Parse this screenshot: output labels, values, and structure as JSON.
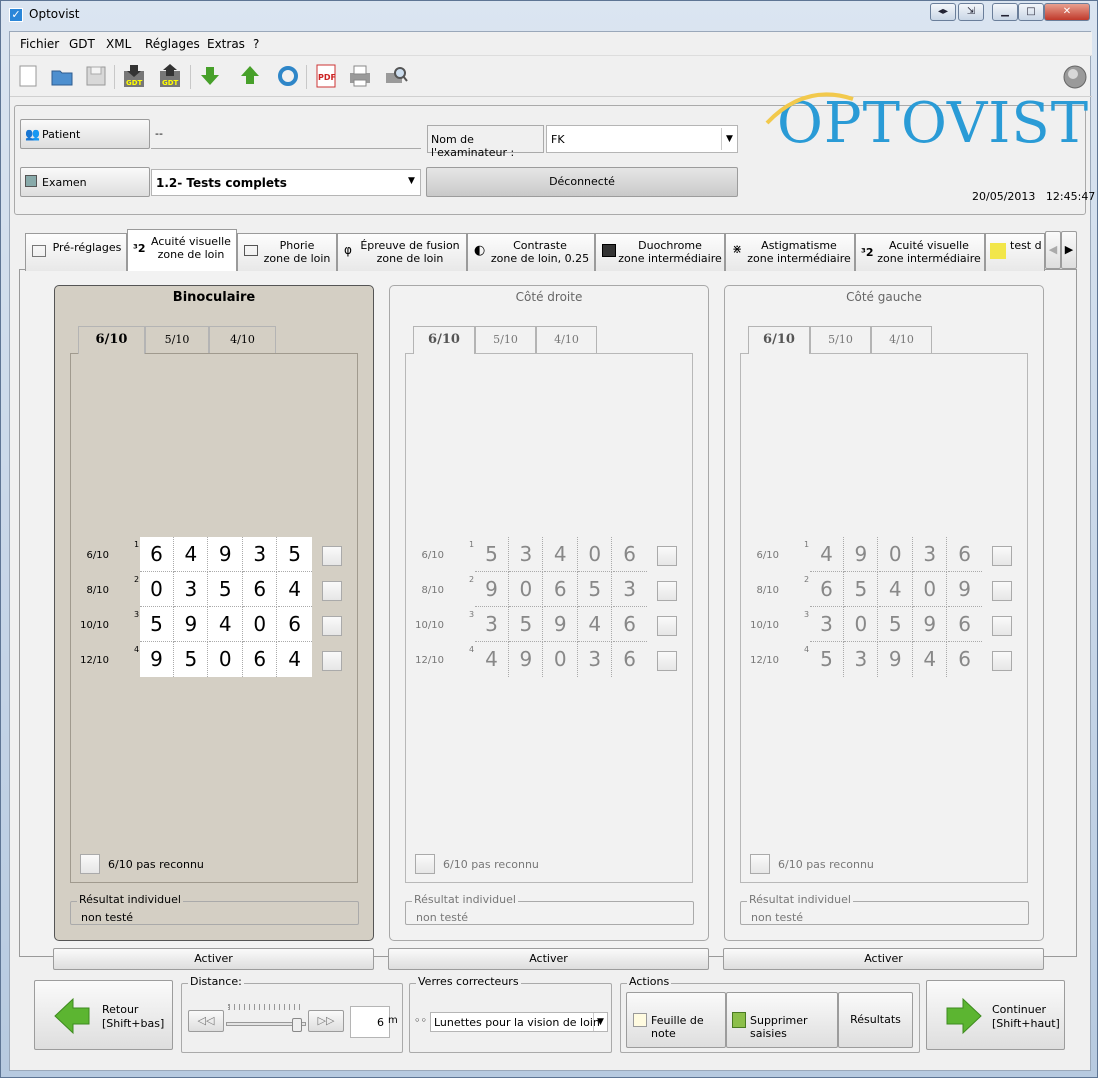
{
  "window": {
    "title": "Optovist"
  },
  "menu": [
    "Fichier",
    "GDT",
    "XML",
    "Réglages",
    "Extras",
    "?"
  ],
  "toolbar_icons": [
    "new-file-icon",
    "open-folder-icon",
    "save-icon",
    "gdt-import-icon",
    "gdt-export-icon",
    "arrow-down-icon",
    "arrow-up-icon",
    "refresh-icon",
    "pdf-icon",
    "print-icon",
    "print-preview-icon"
  ],
  "header": {
    "patient_label": "Patient",
    "patient_value": "--",
    "examen_label": "Examen",
    "examen_value": "1.2- Tests complets",
    "examiner_label": "Nom de l'examinateur :",
    "examiner_value": "FK",
    "connection_button": "Déconnecté",
    "logo": "OPTOVIST",
    "date": "20/05/2013",
    "time": "12:45:47"
  },
  "tabs": [
    {
      "line1": "Pré-réglages",
      "line2": ""
    },
    {
      "line1": "Acuité visuelle",
      "line2": "zone de loin"
    },
    {
      "line1": "Phorie",
      "line2": "zone de loin"
    },
    {
      "line1": "Épreuve de fusion",
      "line2": "zone de loin"
    },
    {
      "line1": "Contraste",
      "line2": "zone de loin, 0.25"
    },
    {
      "line1": "Duochrome",
      "line2": "zone intermédiaire"
    },
    {
      "line1": "Astigmatisme",
      "line2": "zone intermédiaire"
    },
    {
      "line1": "Acuité visuelle",
      "line2": "zone intermédiaire"
    },
    {
      "line1": "test d",
      "line2": ""
    }
  ],
  "panels": [
    {
      "title": "Binoculaire",
      "subtabs": [
        "6/10",
        "5/10",
        "4/10"
      ],
      "rows": [
        {
          "label": "6/10",
          "num": "1",
          "digits": [
            "6",
            "4",
            "9",
            "3",
            "5"
          ]
        },
        {
          "label": "8/10",
          "num": "2",
          "digits": [
            "0",
            "3",
            "5",
            "6",
            "4"
          ]
        },
        {
          "label": "10/10",
          "num": "3",
          "digits": [
            "5",
            "9",
            "4",
            "0",
            "6"
          ]
        },
        {
          "label": "12/10",
          "num": "4",
          "digits": [
            "9",
            "5",
            "0",
            "6",
            "4"
          ]
        }
      ],
      "not_recognized": "6/10 pas reconnu",
      "result_label": "Résultat individuel",
      "result_value": "non testé",
      "activate": "Activer"
    },
    {
      "title": "Côté droite",
      "subtabs": [
        "6/10",
        "5/10",
        "4/10"
      ],
      "rows": [
        {
          "label": "6/10",
          "num": "1",
          "digits": [
            "5",
            "3",
            "4",
            "0",
            "6"
          ]
        },
        {
          "label": "8/10",
          "num": "2",
          "digits": [
            "9",
            "0",
            "6",
            "5",
            "3"
          ]
        },
        {
          "label": "10/10",
          "num": "3",
          "digits": [
            "3",
            "5",
            "9",
            "4",
            "6"
          ]
        },
        {
          "label": "12/10",
          "num": "4",
          "digits": [
            "4",
            "9",
            "0",
            "3",
            "6"
          ]
        }
      ],
      "not_recognized": "6/10 pas reconnu",
      "result_label": "Résultat individuel",
      "result_value": "non testé",
      "activate": "Activer"
    },
    {
      "title": "Côté gauche",
      "subtabs": [
        "6/10",
        "5/10",
        "4/10"
      ],
      "rows": [
        {
          "label": "6/10",
          "num": "1",
          "digits": [
            "4",
            "9",
            "0",
            "3",
            "6"
          ]
        },
        {
          "label": "8/10",
          "num": "2",
          "digits": [
            "6",
            "5",
            "4",
            "0",
            "9"
          ]
        },
        {
          "label": "10/10",
          "num": "3",
          "digits": [
            "3",
            "0",
            "5",
            "9",
            "6"
          ]
        },
        {
          "label": "12/10",
          "num": "4",
          "digits": [
            "5",
            "3",
            "9",
            "4",
            "6"
          ]
        }
      ],
      "not_recognized": "6/10 pas reconnu",
      "result_label": "Résultat individuel",
      "result_value": "non testé",
      "activate": "Activer"
    }
  ],
  "bottom": {
    "back_line1": "Retour",
    "back_line2": "[Shift+bas]",
    "distance_label": "Distance:",
    "distance_value": "6",
    "distance_unit": "m",
    "lenses_label": "Verres correcteurs",
    "lenses_value": "Lunettes pour la vision de loin",
    "actions_label": "Actions",
    "notes_button": "Feuille de note",
    "delete_button": "Supprimer saisies",
    "results_button": "Résultats",
    "continue_line1": "Continuer",
    "continue_line2": "[Shift+haut]"
  },
  "colors": {
    "accent_green": "#5cb531",
    "logo_blue": "#2a9bd6",
    "active_panel": "#d4cfc4"
  }
}
